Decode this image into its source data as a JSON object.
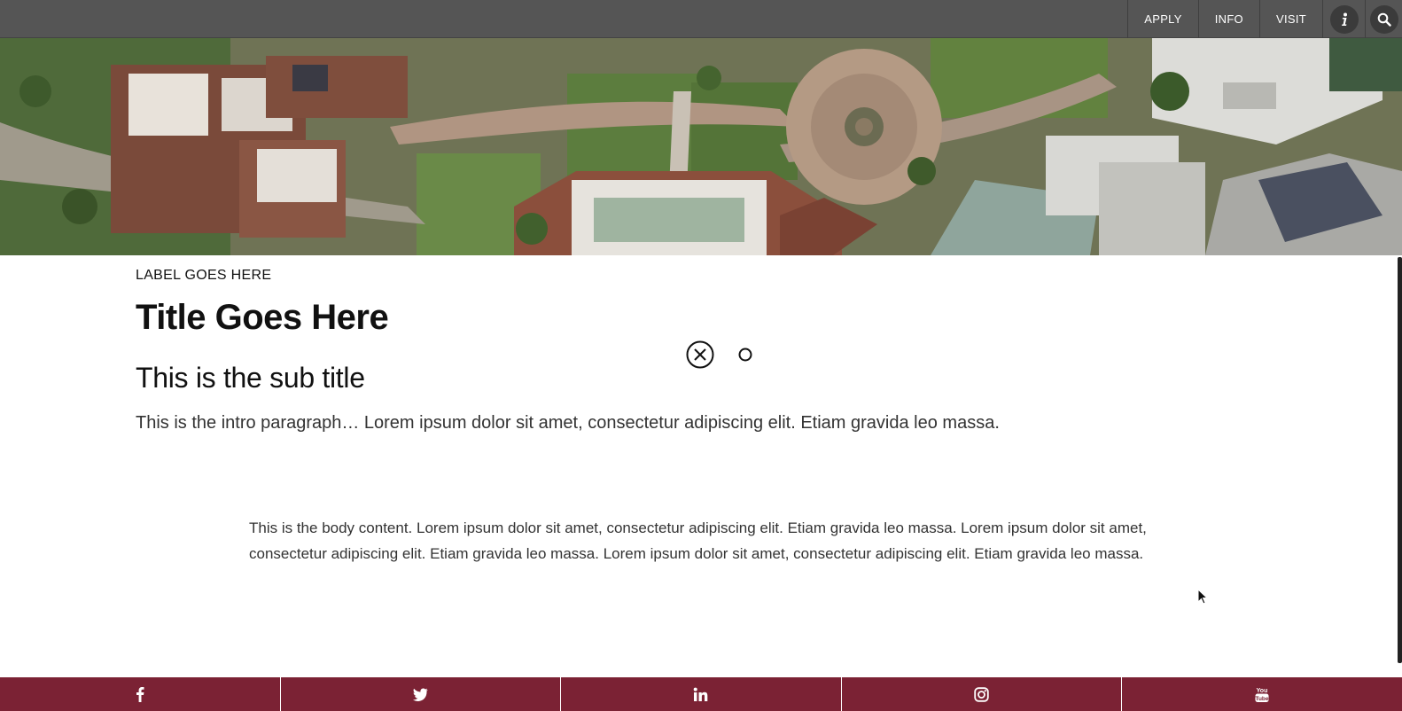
{
  "nav": {
    "links": [
      "APPLY",
      "INFO",
      "VISIT"
    ],
    "info_icon": "info-icon",
    "search_icon": "search-icon",
    "bg_color": "#555555"
  },
  "hero": {
    "image": "aerial-campus-photo"
  },
  "content": {
    "label": "LABEL GOES HERE",
    "title": "Title Goes Here",
    "subtitle": "This is the sub title",
    "intro": "This is the intro paragraph… Lorem ipsum dolor sit amet, consectetur adipiscing elit. Etiam gravida leo massa.",
    "body": "This is the body content. Lorem ipsum dolor sit amet, consectetur adipiscing elit. Etiam gravida leo massa. Lorem ipsum dolor sit amet, consectetur adipiscing elit. Etiam gravida leo massa. Lorem ipsum dolor sit amet, consectetur adipiscing elit. Etiam gravida leo massa."
  },
  "overlay": {
    "close_icon": "close-circle-icon",
    "ring_icon": "ring-icon"
  },
  "social": {
    "bg_color": "#7b2234",
    "items": [
      "facebook-icon",
      "twitter-icon",
      "linkedin-icon",
      "instagram-icon",
      "youtube-icon"
    ]
  }
}
